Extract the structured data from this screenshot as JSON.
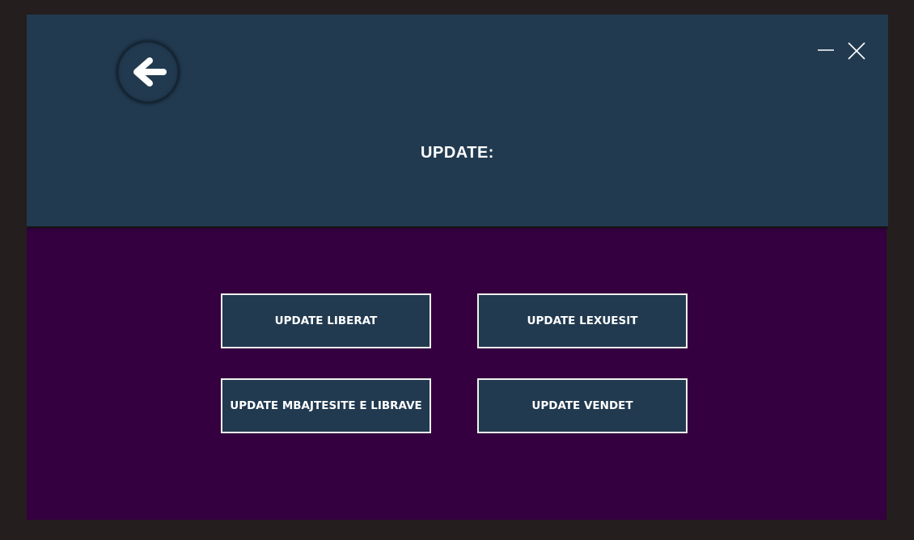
{
  "header": {
    "title": "UPDATE:"
  },
  "window_controls": {
    "back": "back-arrow-icon",
    "minimize": "minimize-icon",
    "close": "close-icon"
  },
  "menu": {
    "buttons": [
      {
        "label": "UPDATE LIBERAT"
      },
      {
        "label": "UPDATE LEXUESIT"
      },
      {
        "label": "UPDATE MBAJTESITE E LIBRAVE"
      },
      {
        "label": "UPDATE VENDET"
      }
    ]
  },
  "colors": {
    "header_bg": "#213a50",
    "content_bg": "#34003f",
    "button_bg": "#213a50",
    "button_border": "#f2f2f2",
    "frame_bg": "#241e1e"
  }
}
